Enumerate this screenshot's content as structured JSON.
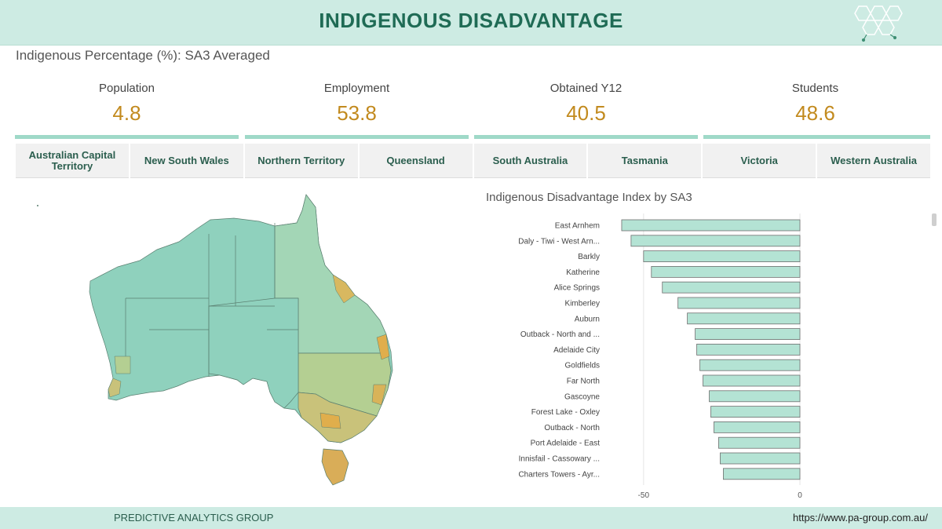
{
  "header": {
    "title": "INDIGENOUS DISADVANTAGE"
  },
  "subtitle": "Indigenous Percentage (%): SA3 Averaged",
  "kpis": [
    {
      "label": "Population",
      "value": "4.8"
    },
    {
      "label": "Employment",
      "value": "53.8"
    },
    {
      "label": "Obtained Y12",
      "value": "40.5"
    },
    {
      "label": "Students",
      "value": "48.6"
    }
  ],
  "states": [
    "Australian Capital Territory",
    "New South Wales",
    "Northern Territory",
    "Queensland",
    "South Australia",
    "Tasmania",
    "Victoria",
    "Western Australia"
  ],
  "colors": {
    "accent": "#1f6b55",
    "value": "#c28a1e",
    "bar": "#b4e3d4",
    "header_bg": "#cdebe3"
  },
  "chart_data": {
    "type": "bar",
    "orientation": "horizontal",
    "title": "Indigenous Disadvantage Index by SA3",
    "categories": [
      "East Arnhem",
      "Daly - Tiwi - West Arn...",
      "Barkly",
      "Katherine",
      "Alice Springs",
      "Kimberley",
      "Auburn",
      "Outback - North and ...",
      "Adelaide City",
      "Goldfields",
      "Far North",
      "Gascoyne",
      "Forest Lake - Oxley",
      "Outback - North",
      "Port Adelaide - East",
      "Innisfail - Cassowary ...",
      "Charters Towers - Ayr..."
    ],
    "values": [
      -57,
      -54,
      -50,
      -47.5,
      -44,
      -39,
      -36,
      -33.5,
      -33,
      -32,
      -31,
      -29,
      -28.5,
      -27.5,
      -26,
      -25.5,
      -24.5
    ],
    "xticks": [
      -50,
      0
    ],
    "xlim": [
      -60,
      0
    ]
  },
  "footer": {
    "left": "PREDICTIVE ANALYTICS GROUP",
    "right": "https://www.pa-group.com.au/"
  }
}
